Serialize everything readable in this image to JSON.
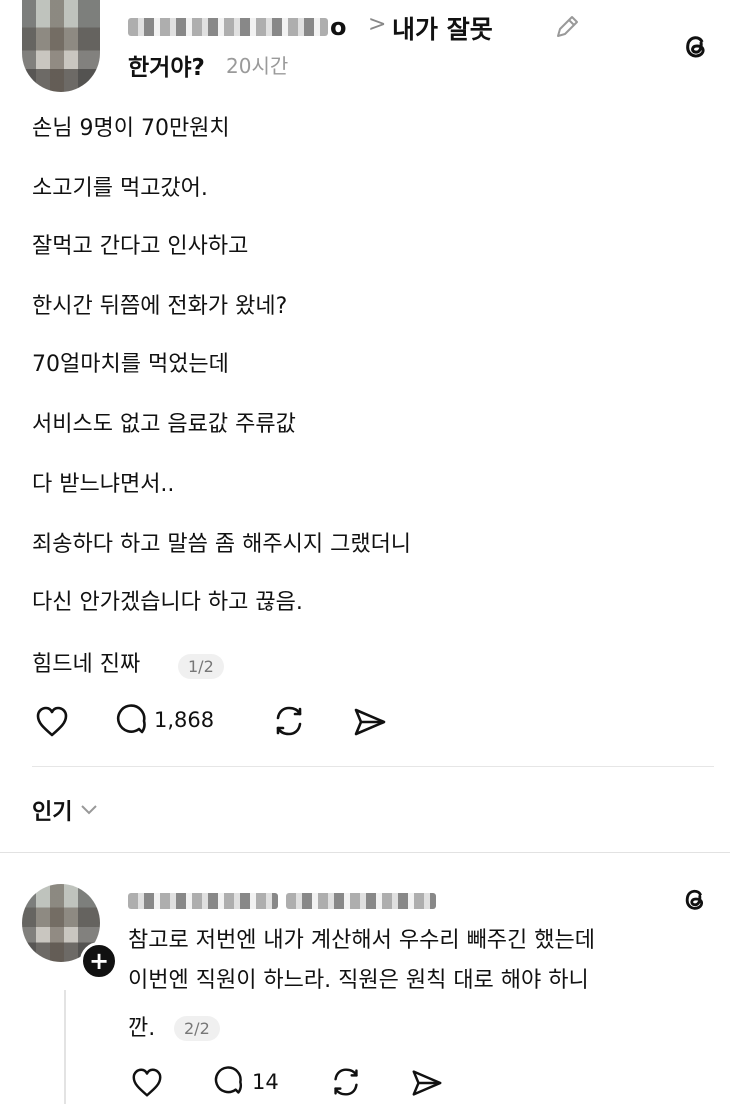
{
  "post": {
    "author_suffix": "o",
    "separator": ">",
    "topic_line1": "내가 잘못",
    "topic_line2": "한거야?",
    "time": "20시간",
    "lines": [
      "손님 9명이 70만원치",
      "소고기를 먹고갔어.",
      "잘먹고 간다고 인사하고",
      "한시간 뒤쯤에 전화가 왔네?",
      "70얼마치를 먹었는데",
      "서비스도 없고 음료값 주류값",
      "다 받느냐면서..",
      "죄송하다 하고 말씀 좀 해주시지 그랬더니",
      "다신 안가겠습니다 하고 끊음."
    ],
    "last_line": "힘드네 진짜",
    "page_indicator": "1/2",
    "reply_count": "1,868"
  },
  "sort": {
    "label": "인기"
  },
  "reply": {
    "lines": [
      "참고로 저번엔 내가 계산해서 우수리 빼주긴 했는데",
      "이번엔 직원이 하느라. 직원은 원칙 대로 해야 하니",
      "깐."
    ],
    "page_indicator": "2/2",
    "reply_count": "14"
  },
  "icons": [
    "edit-icon",
    "threads-icon",
    "heart-icon",
    "comment-icon",
    "repost-icon",
    "share-icon",
    "chevron-down-icon",
    "follow-plus-icon"
  ]
}
